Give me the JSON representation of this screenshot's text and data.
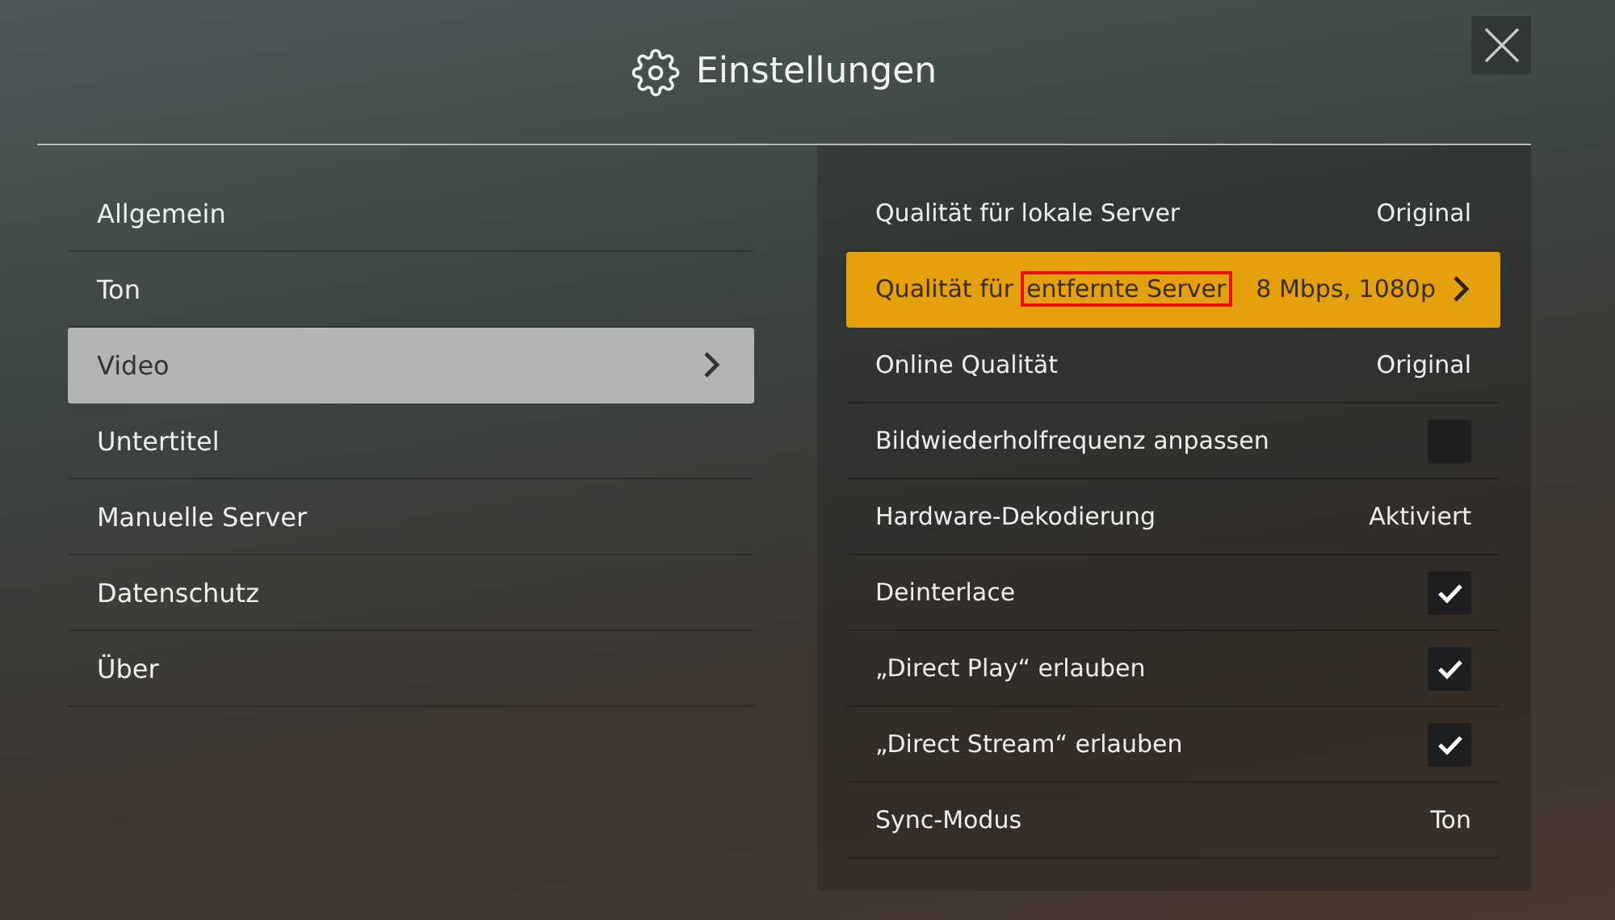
{
  "header": {
    "title": "Einstellungen"
  },
  "categories": [
    {
      "label": "Allgemein",
      "selected": false
    },
    {
      "label": "Ton",
      "selected": false
    },
    {
      "label": "Video",
      "selected": true
    },
    {
      "label": "Untertitel",
      "selected": false
    },
    {
      "label": "Manuelle Server",
      "selected": false
    },
    {
      "label": "Datenschutz",
      "selected": false
    },
    {
      "label": "Über",
      "selected": false
    }
  ],
  "settings": [
    {
      "kind": "value",
      "label": "Qualität für lokale Server",
      "value": "Original",
      "selected": false
    },
    {
      "kind": "value",
      "label": "Qualität für",
      "highlighted_label": "entfernte Server",
      "value": "8 Mbps, 1080p",
      "selected": true
    },
    {
      "kind": "value",
      "label": "Online Qualität",
      "value": "Original",
      "selected": false
    },
    {
      "kind": "checkbox",
      "label": "Bildwiederholfrequenz anpassen",
      "checked": false,
      "selected": false
    },
    {
      "kind": "value",
      "label": "Hardware-Dekodierung",
      "value": "Aktiviert",
      "selected": false
    },
    {
      "kind": "checkbox",
      "label": "Deinterlace",
      "checked": true,
      "selected": false
    },
    {
      "kind": "checkbox",
      "label": "„Direct Play“ erlauben",
      "checked": true,
      "selected": false
    },
    {
      "kind": "checkbox",
      "label": "„Direct Stream“ erlauben",
      "checked": true,
      "selected": false
    },
    {
      "kind": "value",
      "label": "Sync-Modus",
      "value": "Ton",
      "selected": false
    }
  ]
}
